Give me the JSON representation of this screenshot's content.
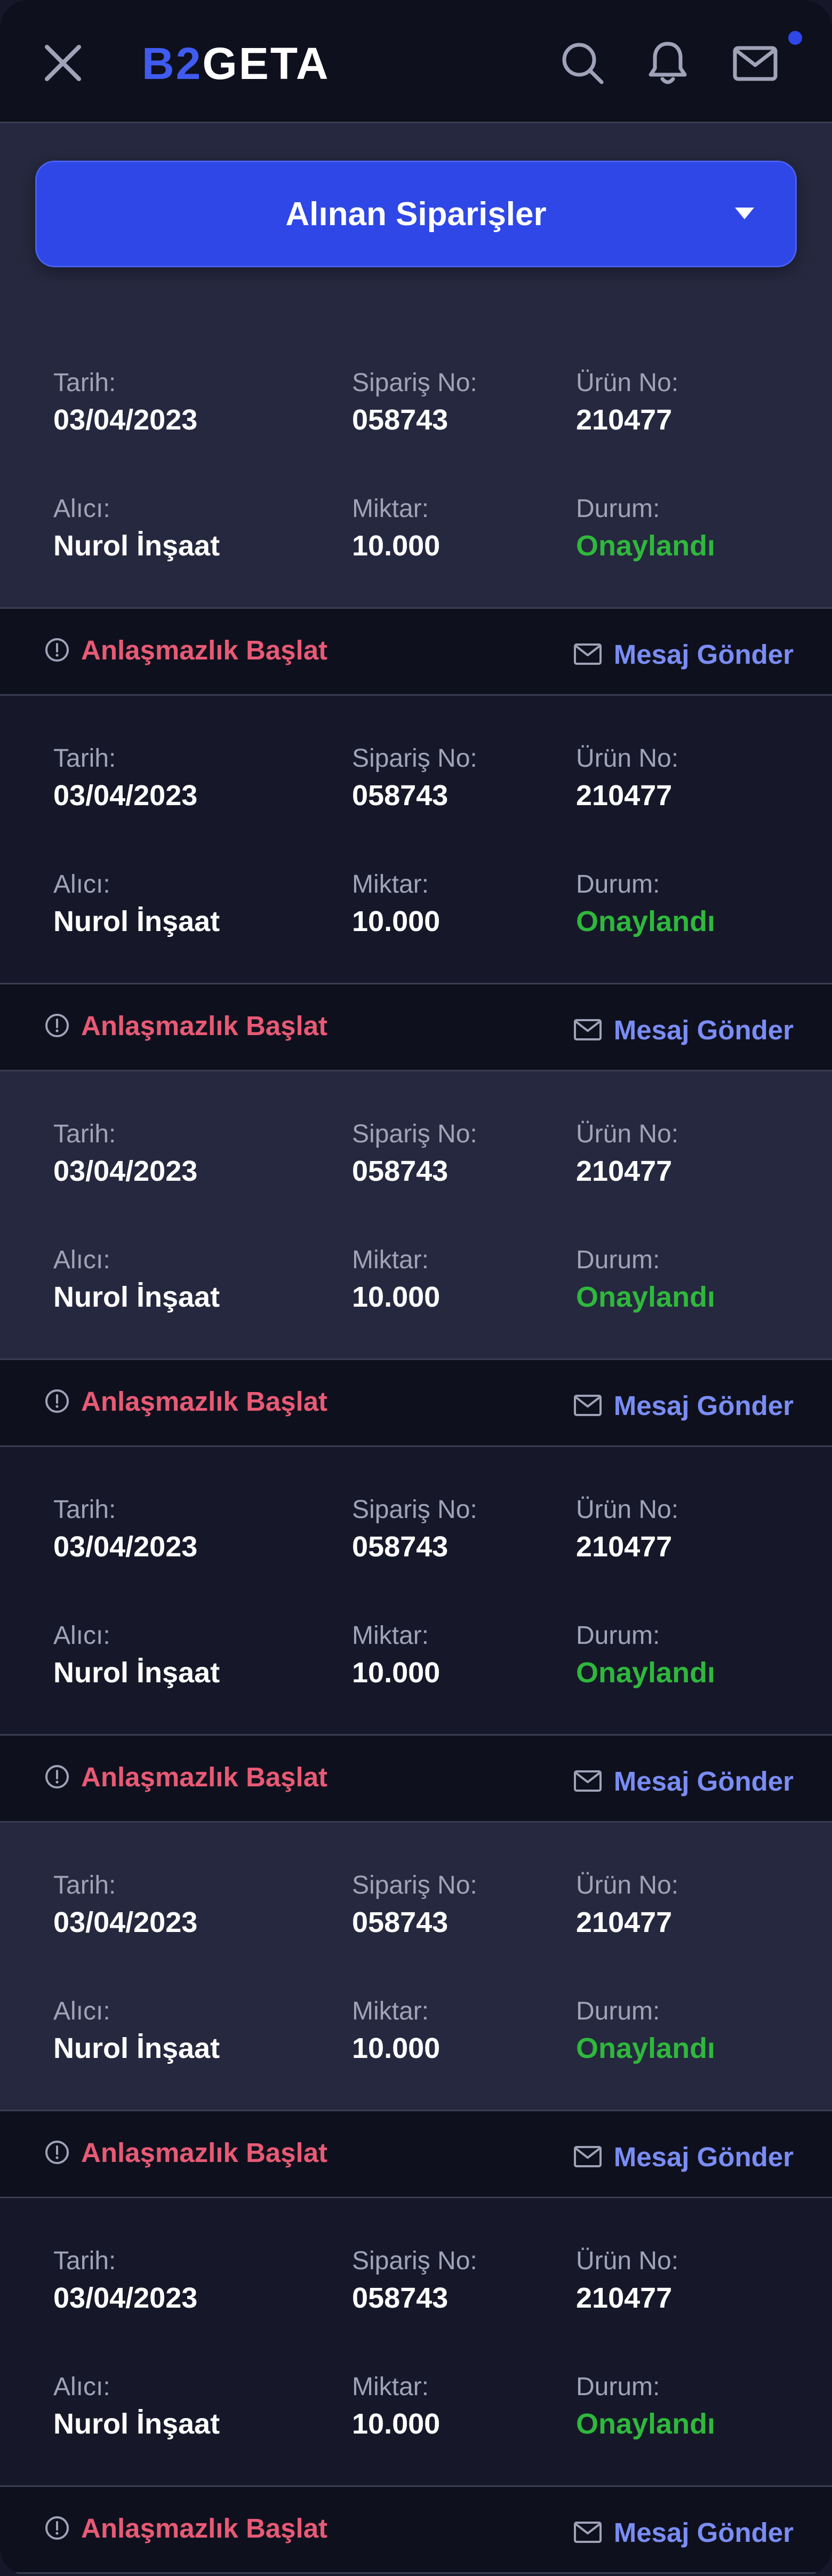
{
  "header": {
    "logo_b2": "B2",
    "logo_geta": "GETA",
    "icons": [
      "close-icon",
      "search-icon",
      "bell-icon",
      "mail-icon"
    ],
    "has_notification_dot": true
  },
  "selector": {
    "label": "Alınan Siparişler",
    "icon": "chevron-down-icon"
  },
  "labels": {
    "date": "Tarih:",
    "order_no": "Sipariş No:",
    "product_no": "Ürün No:",
    "buyer": "Alıcı:",
    "quantity": "Miktar:",
    "status": "Durum:",
    "dispute": "Anlaşmazlık Başlat",
    "message": "Mesaj Gönder"
  },
  "colors": {
    "brand": "#2e47e6",
    "status_approved": "#2fb83c",
    "dispute": "#e85a75",
    "message": "#7a8df5"
  },
  "orders": [
    {
      "date": "03/04/2023",
      "order_no": "058743",
      "product_no": "210477",
      "buyer": "Nurol İnşaat",
      "quantity": "10.000",
      "status": "Onaylandı"
    },
    {
      "date": "03/04/2023",
      "order_no": "058743",
      "product_no": "210477",
      "buyer": "Nurol İnşaat",
      "quantity": "10.000",
      "status": "Onaylandı"
    },
    {
      "date": "03/04/2023",
      "order_no": "058743",
      "product_no": "210477",
      "buyer": "Nurol İnşaat",
      "quantity": "10.000",
      "status": "Onaylandı"
    },
    {
      "date": "03/04/2023",
      "order_no": "058743",
      "product_no": "210477",
      "buyer": "Nurol İnşaat",
      "quantity": "10.000",
      "status": "Onaylandı"
    },
    {
      "date": "03/04/2023",
      "order_no": "058743",
      "product_no": "210477",
      "buyer": "Nurol İnşaat",
      "quantity": "10.000",
      "status": "Onaylandı"
    },
    {
      "date": "03/04/2023",
      "order_no": "058743",
      "product_no": "210477",
      "buyer": "Nurol İnşaat",
      "quantity": "10.000",
      "status": "Onaylandı"
    }
  ]
}
